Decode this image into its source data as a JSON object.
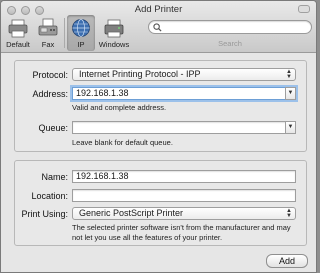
{
  "window": {
    "title": "Add Printer"
  },
  "toolbar": {
    "items": [
      {
        "label": "Default",
        "icon": "default-printer-icon"
      },
      {
        "label": "Fax",
        "icon": "fax-icon"
      },
      {
        "label": "IP",
        "icon": "ip-globe-icon",
        "selected": true
      },
      {
        "label": "Windows",
        "icon": "windows-printer-icon"
      }
    ],
    "search": {
      "label": "Search",
      "value": ""
    }
  },
  "connection": {
    "protocol_label": "Protocol:",
    "protocol_value": "Internet Printing Protocol - IPP",
    "address_label": "Address:",
    "address_value": "192.168.1.38",
    "address_hint": "Valid and complete address.",
    "queue_label": "Queue:",
    "queue_value": "",
    "queue_hint": "Leave blank for default queue."
  },
  "details": {
    "name_label": "Name:",
    "name_value": "192.168.1.38",
    "location_label": "Location:",
    "location_value": "",
    "print_using_label": "Print Using:",
    "print_using_value": "Generic PostScript Printer",
    "print_using_warning": "The selected printer software isn't from the manufacturer and may not let you use all the features of your printer."
  },
  "actions": {
    "add_label": "Add"
  }
}
